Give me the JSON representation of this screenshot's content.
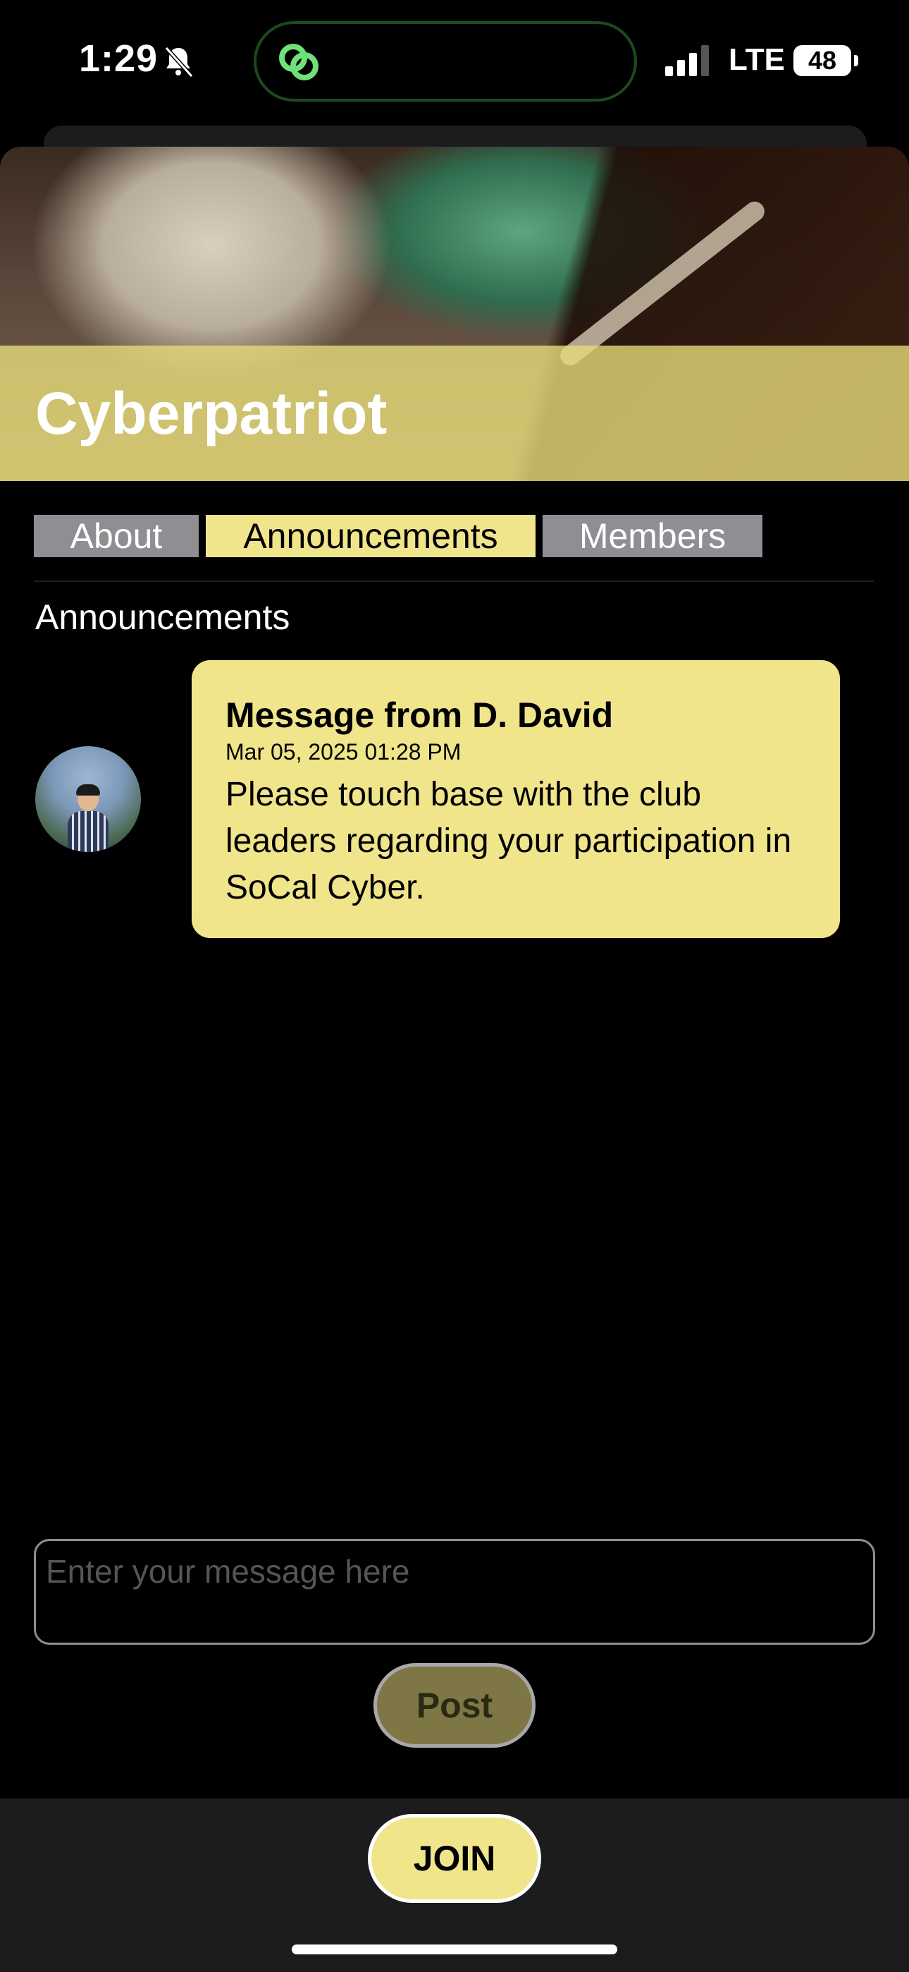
{
  "status_bar": {
    "time": "1:29",
    "network": "LTE",
    "battery": "48"
  },
  "club": {
    "name": "Cyberpatriot"
  },
  "tabs": [
    {
      "label": "About",
      "selected": false
    },
    {
      "label": "Announcements",
      "selected": true
    },
    {
      "label": "Members",
      "selected": false
    }
  ],
  "section": {
    "title": "Announcements"
  },
  "announcements": [
    {
      "title": "Message from D. David",
      "date": "Mar 05, 2025 01:28 PM",
      "body": "Please touch base with the club leaders regarding your participation in SoCal Cyber."
    }
  ],
  "composer": {
    "placeholder": "Enter your message here",
    "post_label": "Post"
  },
  "footer": {
    "join_label": "JOIN"
  },
  "colors": {
    "accent": "#f0e58a",
    "tab_inactive": "#8e8e93",
    "background": "#000000",
    "bottom_bar": "#1c1c1e"
  }
}
